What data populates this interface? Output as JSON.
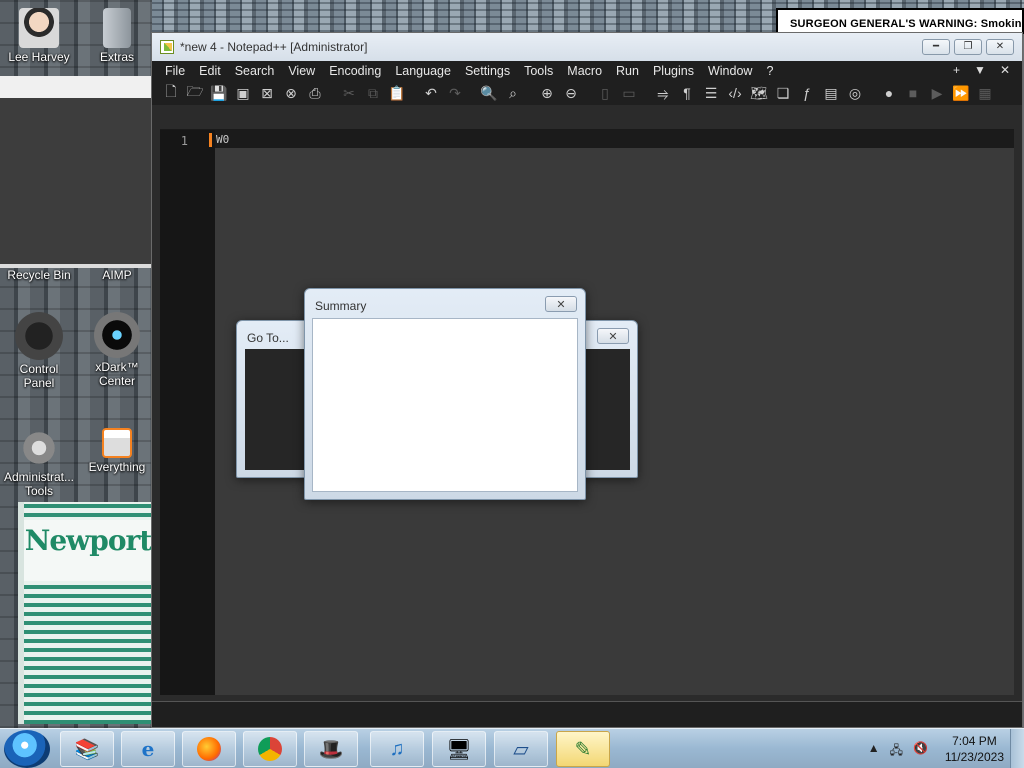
{
  "desktop": {
    "icons": [
      {
        "label": "Lee Harvey"
      },
      {
        "label": "Extras"
      },
      {
        "label": "Recycle Bin"
      },
      {
        "label": "AIMP"
      },
      {
        "label": "Control Panel"
      },
      {
        "label": "xDark™ Center"
      },
      {
        "label": "Administrat... Tools"
      },
      {
        "label": "Everything"
      }
    ],
    "warning_text": "SURGEON GENERAL'S WARNING: Smoking",
    "package_brand": "Newport"
  },
  "notepad": {
    "title": "*new 4 - Notepad++ [Administrator]",
    "menu": [
      "File",
      "Edit",
      "Search",
      "View",
      "Encoding",
      "Language",
      "Settings",
      "Tools",
      "Macro",
      "Run",
      "Plugins",
      "Window",
      "?"
    ],
    "menu_right": [
      "+",
      "▼",
      "✕"
    ],
    "editor": {
      "line_number": "1",
      "line_text": "W0"
    }
  },
  "dialogs": {
    "goto_title": "Go To...",
    "summary_title": "Summary"
  },
  "taskbar": {
    "time": "7:04 PM",
    "date": "11/23/2023"
  },
  "colors": {
    "editor_bg": "#3a3a3a",
    "gutter_bg": "#161616",
    "menubar_bg": "#1f1f1f",
    "fold_accent": "#f58220"
  }
}
